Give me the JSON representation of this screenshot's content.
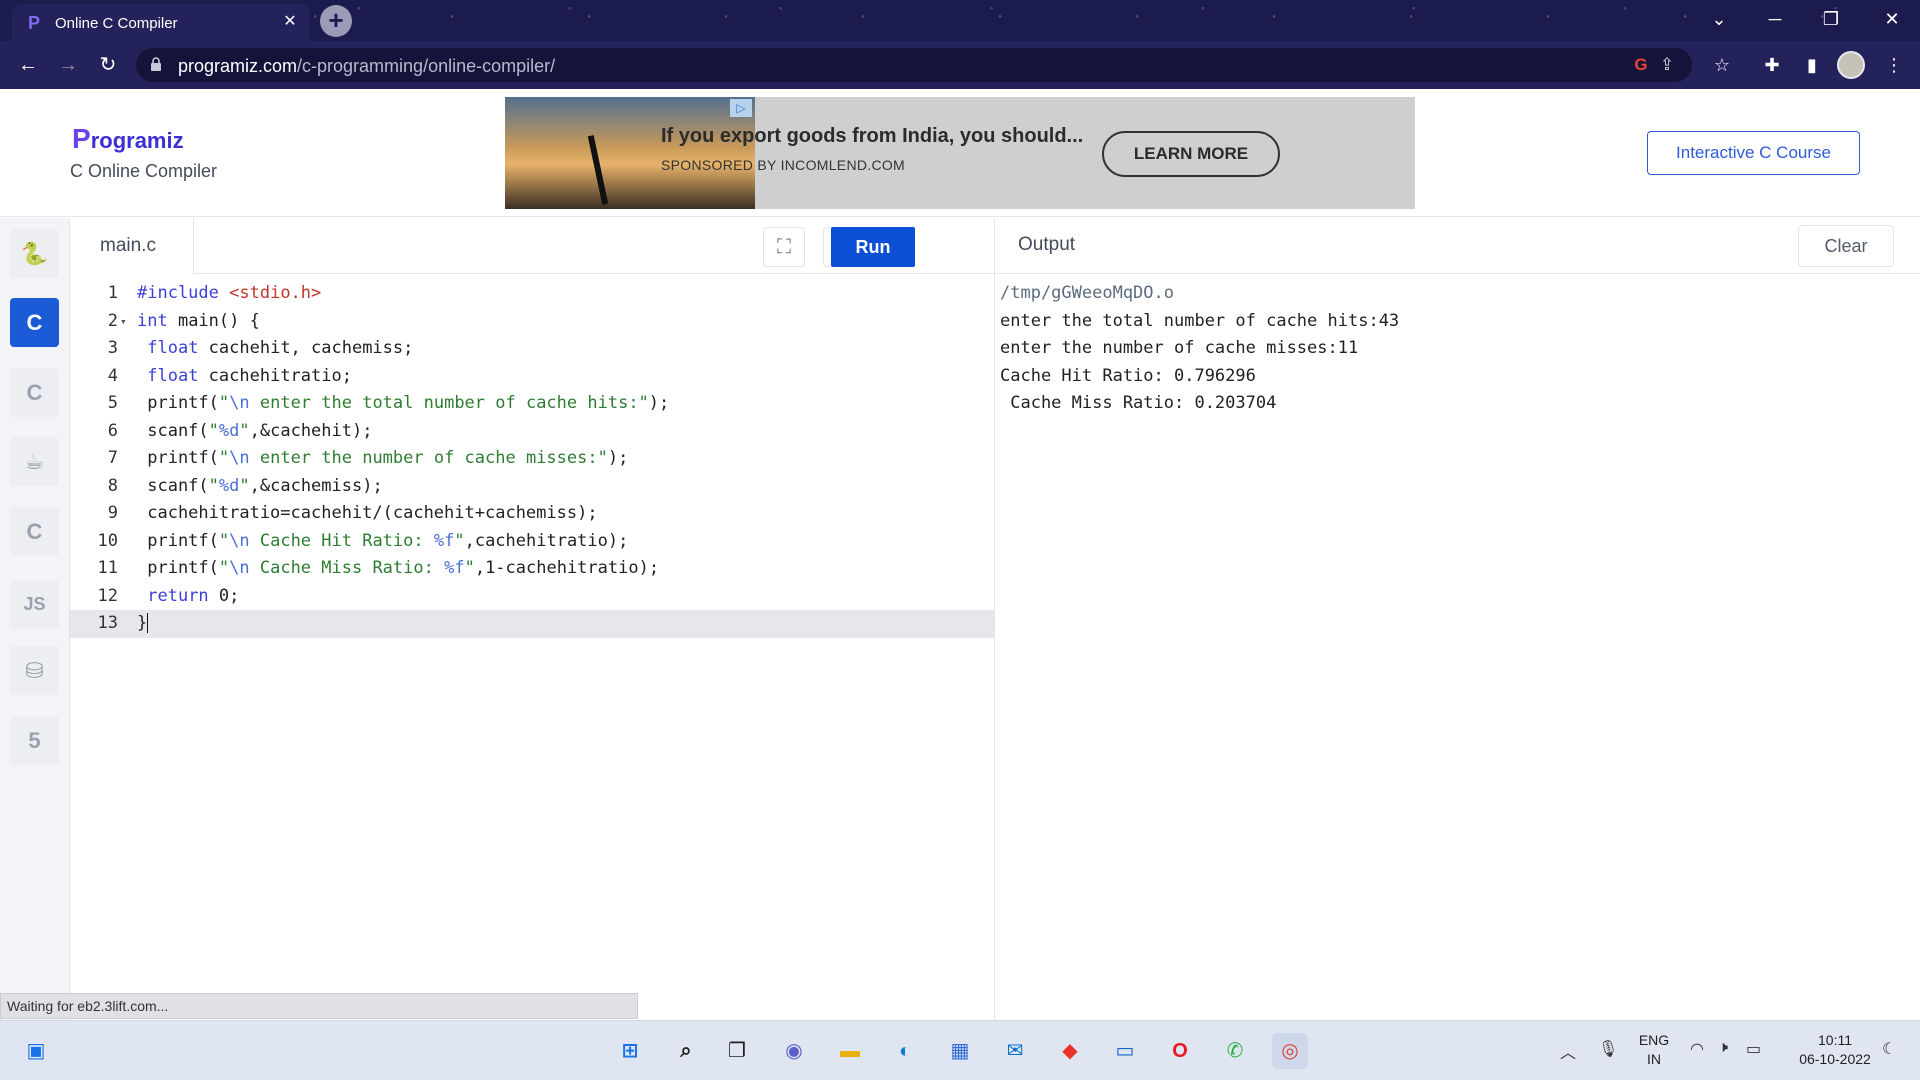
{
  "browser": {
    "tab_title": "Online C Compiler",
    "url_domain": "programiz.com",
    "url_path": "/c-programming/online-compiler/"
  },
  "header": {
    "logo_first": "P",
    "logo_rest": "rogramiz",
    "subtitle": "C Online Compiler",
    "course_button": "Interactive C Course"
  },
  "ad": {
    "headline": "If you export goods from India, you should...",
    "sponsor": "SPONSORED BY INCOMLEND.COM",
    "cta": "LEARN MORE"
  },
  "sidebar": {
    "languages": [
      {
        "icon": "python-icon",
        "glyph": "🐍"
      },
      {
        "icon": "c-icon",
        "glyph": "C"
      },
      {
        "icon": "cpp-icon",
        "glyph": "C"
      },
      {
        "icon": "java-icon",
        "glyph": "☕"
      },
      {
        "icon": "csharp-icon",
        "glyph": "C"
      },
      {
        "icon": "js-icon",
        "glyph": "JS"
      },
      {
        "icon": "sql-icon",
        "glyph": "⛁"
      },
      {
        "icon": "html-icon",
        "glyph": "5"
      }
    ],
    "active_index": 1
  },
  "editor": {
    "filename": "main.c",
    "run_label": "Run",
    "code_lines": [
      {
        "n": "1",
        "text": "#include <stdio.h>"
      },
      {
        "n": "2",
        "text": "int main() {"
      },
      {
        "n": "3",
        "text": " float cachehit, cachemiss;"
      },
      {
        "n": "4",
        "text": " float cachehitratio;"
      },
      {
        "n": "5",
        "text": " printf(\"\\n enter the total number of cache hits:\");"
      },
      {
        "n": "6",
        "text": " scanf(\"%d\",&cachehit);"
      },
      {
        "n": "7",
        "text": " printf(\"\\n enter the number of cache misses:\");"
      },
      {
        "n": "8",
        "text": " scanf(\"%d\",&cachemiss);"
      },
      {
        "n": "9",
        "text": " cachehitratio=cachehit/(cachehit+cachemiss);"
      },
      {
        "n": "10",
        "text": " printf(\"\\n Cache Hit Ratio: %f\",cachehitratio);"
      },
      {
        "n": "11",
        "text": " printf(\"\\n Cache Miss Ratio: %f\",1-cachehitratio);"
      },
      {
        "n": "12",
        "text": " return 0;"
      },
      {
        "n": "13",
        "text": "}"
      }
    ]
  },
  "output": {
    "title": "Output",
    "clear_label": "Clear",
    "lines": [
      "/tmp/gGWeeoMqDO.o",
      "enter the total number of cache hits:43",
      "enter the number of cache misses:11",
      "Cache Hit Ratio: 0.796296",
      " Cache Miss Ratio: 0.203704"
    ]
  },
  "status": {
    "text": "Waiting for eb2.3lift.com..."
  },
  "taskbar": {
    "language": "ENG",
    "region": "IN",
    "time": "10:11",
    "date": "06-10-2022"
  }
}
